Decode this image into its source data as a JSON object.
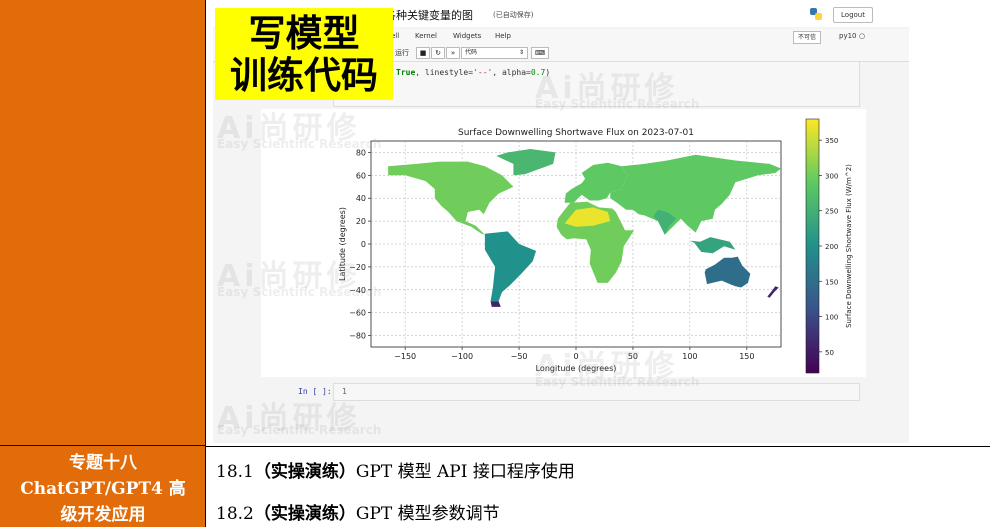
{
  "left_panel": {
    "topic_lines": [
      "专题十八",
      "ChatGPT/GPT4 高",
      "级开发应用"
    ]
  },
  "lessons": [
    {
      "number": "18.1",
      "tag": "（实操演练）",
      "text": "GPT 模型 API 接口程序使用"
    },
    {
      "number": "18.2",
      "tag": "（实操演练）",
      "text": "GPT 模型参数调节"
    }
  ],
  "banner": {
    "line1": "写模型",
    "line2": "训练代码",
    "color": "#ffff00"
  },
  "notebook": {
    "title_fragment": "各种关键变量的图",
    "autosave": "(已自动保存)",
    "logout_label": "Logout",
    "menu": [
      "ell",
      "Kernel",
      "Widgets",
      "Help"
    ],
    "trusted_label": "不可信",
    "kernel_name": "py10",
    "run_label": "运行",
    "celltype": "代码",
    "code_text": "True, linestyle='--', alpha=0.7)",
    "code_kw": "True",
    "code_rest1": ", linestyle=",
    "code_str": "'--'",
    "code_rest2": ", alpha=",
    "code_num": "0.7",
    "code_close": ")",
    "input_prompt": "In [ ]:",
    "input_line": "1"
  },
  "watermark": {
    "brand": "Ai尚研修",
    "tagline": "Easy Scientific Research"
  },
  "chart_data": {
    "type": "heatmap",
    "title": "Surface Downwelling Shortwave Flux on 2023-07-01",
    "xlabel": "Longitude (degrees)",
    "ylabel": "Latitude (degrees)",
    "colorbar_label": "Surface Downwelling Shortwave Flux (W/m^2)",
    "xlim": [
      -180,
      180
    ],
    "ylim": [
      -90,
      90
    ],
    "xticks": [
      -150,
      -100,
      -50,
      0,
      50,
      100,
      150
    ],
    "yticks": [
      80,
      60,
      40,
      20,
      0,
      -20,
      -40,
      -60,
      -80
    ],
    "clim": [
      20,
      380
    ],
    "colorbar_ticks": [
      350,
      300,
      250,
      200,
      150,
      100,
      50
    ],
    "colormap": "viridis",
    "grid": true,
    "grid_style": "dashed",
    "regions": [
      {
        "name": "North America",
        "value": 300
      },
      {
        "name": "Greenland",
        "value": 260
      },
      {
        "name": "South America",
        "value": 200
      },
      {
        "name": "Patagonia",
        "value": 60
      },
      {
        "name": "Europe",
        "value": 290
      },
      {
        "name": "Africa",
        "value": 300
      },
      {
        "name": "Sahara",
        "value": 370
      },
      {
        "name": "Asia",
        "value": 290
      },
      {
        "name": "India",
        "value": 250
      },
      {
        "name": "Southeast Asia",
        "value": 230
      },
      {
        "name": "Australia",
        "value": 150
      },
      {
        "name": "New Zealand",
        "value": 60
      }
    ]
  }
}
